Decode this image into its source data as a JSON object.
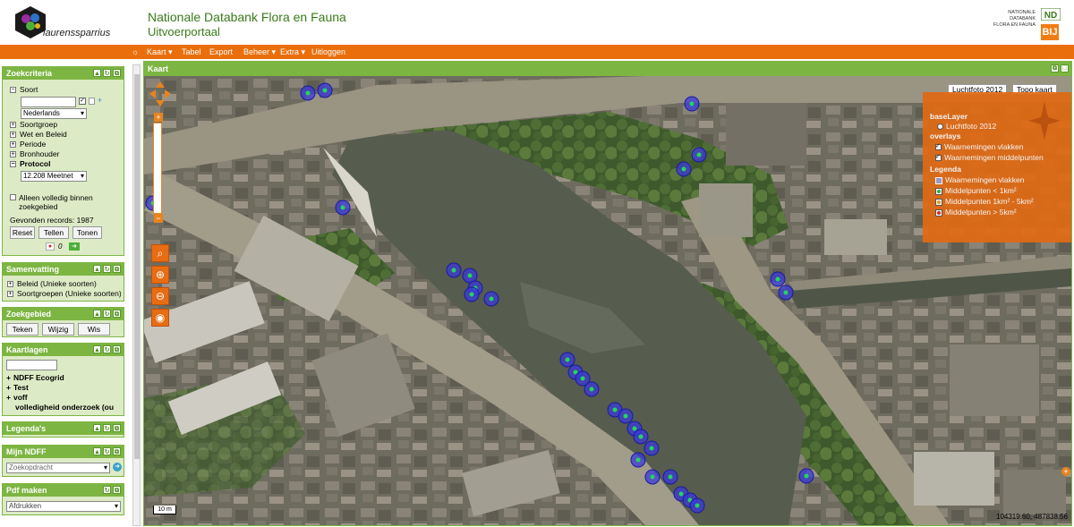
{
  "header": {
    "username": "laurenssparrius",
    "title_line1": "Nationale Databank Flora en Fauna",
    "title_line2": "Uitvoerportaal",
    "ndff_small_line1": "NATIONALE DATABANK",
    "ndff_small_line2": "FLORA EN FAUNA",
    "ndff_logo_text": "ND",
    "bij12_logo_text": "BIJ"
  },
  "menu": {
    "items": [
      "Kaart ▾",
      "Tabel",
      "Export",
      "Beheer ▾",
      "Extra ▾",
      "Uitloggen"
    ]
  },
  "zoekcriteria": {
    "title": "Zoekcriteria",
    "soort_label": "Soort",
    "language_select": "Nederlands",
    "soortgroep": "Soortgroep",
    "wet_en_beleid": "Wet en Beleid",
    "periode": "Periode",
    "bronhouder": "Bronhouder",
    "protocol": "Protocol",
    "protocol_select": "12.208 Meetnet",
    "alleen_line1": "Alleen volledig binnen",
    "alleen_line2": "zoekgebied",
    "gevonden": "Gevonden records: 1987",
    "reset": "Reset",
    "tellen": "Tellen",
    "tonen": "Tonen",
    "count": "0"
  },
  "samenvatting": {
    "title": "Samenvatting",
    "items": [
      "Beleid (Unieke soorten)",
      "Soortgroepen (Unieke soorten)"
    ]
  },
  "zoekgebied": {
    "title": "Zoekgebied",
    "teken": "Teken",
    "wijzig": "Wijzig",
    "wis": "Wis"
  },
  "kaartlagen": {
    "title": "Kaartlagen",
    "items": [
      "NDFF Ecogrid",
      "Test",
      "voff",
      "volledigheid onderzoek (ou"
    ]
  },
  "legendas": {
    "title": "Legenda's"
  },
  "mijn_ndff": {
    "title": "Mijn NDFF",
    "select": "Zoekopdracht"
  },
  "pdf_maken": {
    "title": "Pdf maken",
    "select": "Afdrukken"
  },
  "map": {
    "title": "Kaart",
    "btn_luchtfoto": "Luchtfoto 2012",
    "btn_topo": "Topo kaart",
    "layer_panel": {
      "baselayer": "baseLayer",
      "luchtfoto": "Luchtfoto 2012",
      "overlays": "overlays",
      "overlay1": "Waarnemingen vlakken",
      "overlay2": "Waarnemingen middelpunten",
      "legenda": "Legenda",
      "leg1": "Waarnemingen vlakken",
      "leg2": "Middelpunten < 1km²",
      "leg3": "Middelpunten 1km² - 5km²",
      "leg4": "Middelpunten > 5km²"
    },
    "scale": "10 m",
    "coords": "104319.60, 487838.56"
  },
  "colors": {
    "accent_orange": "#ea6f0c",
    "panel_green": "#7db542",
    "marker_blue": "#3a3ad8",
    "marker_green": "#27d35b"
  }
}
